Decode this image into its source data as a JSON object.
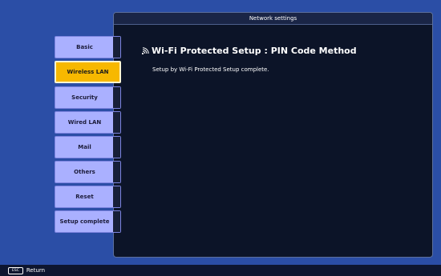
{
  "panel": {
    "title": "Network settings",
    "heading": "Wi-Fi Protected Setup : PIN Code Method",
    "message": "Setup by Wi-Fi Protected Setup complete."
  },
  "menu": {
    "items": [
      {
        "label": "Basic"
      },
      {
        "label": "Wireless LAN",
        "selected": true
      },
      {
        "label": "Security"
      },
      {
        "label": "Wired LAN"
      },
      {
        "label": "Mail"
      },
      {
        "label": "Others"
      },
      {
        "label": "Reset"
      },
      {
        "label": "Setup complete"
      }
    ]
  },
  "footer": {
    "key": "ESC",
    "action": "Return"
  },
  "icons": {
    "heading_icon": "wifi-signal-icon"
  },
  "colors": {
    "background": "#2b4ea6",
    "panel": "#0c1428",
    "button": "#aab0ff",
    "button_selected": "#f7b800"
  }
}
